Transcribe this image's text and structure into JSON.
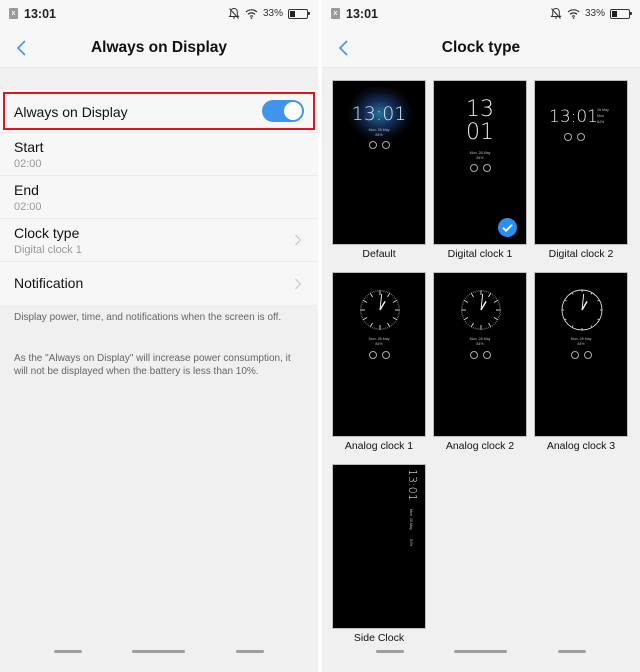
{
  "status_bar": {
    "time": "13:01",
    "battery_percent": "33%",
    "battery_level": 0.33,
    "icons": [
      "sim-card-icon",
      "mute-bell-icon",
      "wifi-icon",
      "battery-icon"
    ]
  },
  "left_screen": {
    "title": "Always on Display",
    "back_icon": "chevron-left-icon",
    "aod_toggle": {
      "label": "Always on Display",
      "on": true
    },
    "rows": [
      {
        "label": "Start",
        "value": "02:00"
      },
      {
        "label": "End",
        "value": "02:00"
      },
      {
        "label": "Clock type",
        "value": "Digital clock 1"
      },
      {
        "label": "Notification"
      }
    ],
    "description": "Display power, time, and notifications when the screen is off.",
    "warning": "As the \"Always on Display\" will increase power consumption, it will not be displayed when the battery is less than 10%."
  },
  "right_screen": {
    "title": "Clock type",
    "back_icon": "chevron-left-icon",
    "selected": "Digital clock 1",
    "preview": {
      "time": "13:01",
      "hour": "13",
      "minute": "01",
      "date": "Mon. 28 May",
      "date_short": "28 May",
      "weekday": "Mon",
      "battery": "84%"
    },
    "options": [
      {
        "label": "Default"
      },
      {
        "label": "Digital clock 1"
      },
      {
        "label": "Digital clock 2"
      },
      {
        "label": "Analog clock 1"
      },
      {
        "label": "Analog clock 2"
      },
      {
        "label": "Analog clock 3"
      },
      {
        "label": "Side Clock"
      }
    ]
  },
  "colors": {
    "accent": "#3f95eb",
    "highlight": "#e0141a",
    "background": "#f0f0f0"
  }
}
